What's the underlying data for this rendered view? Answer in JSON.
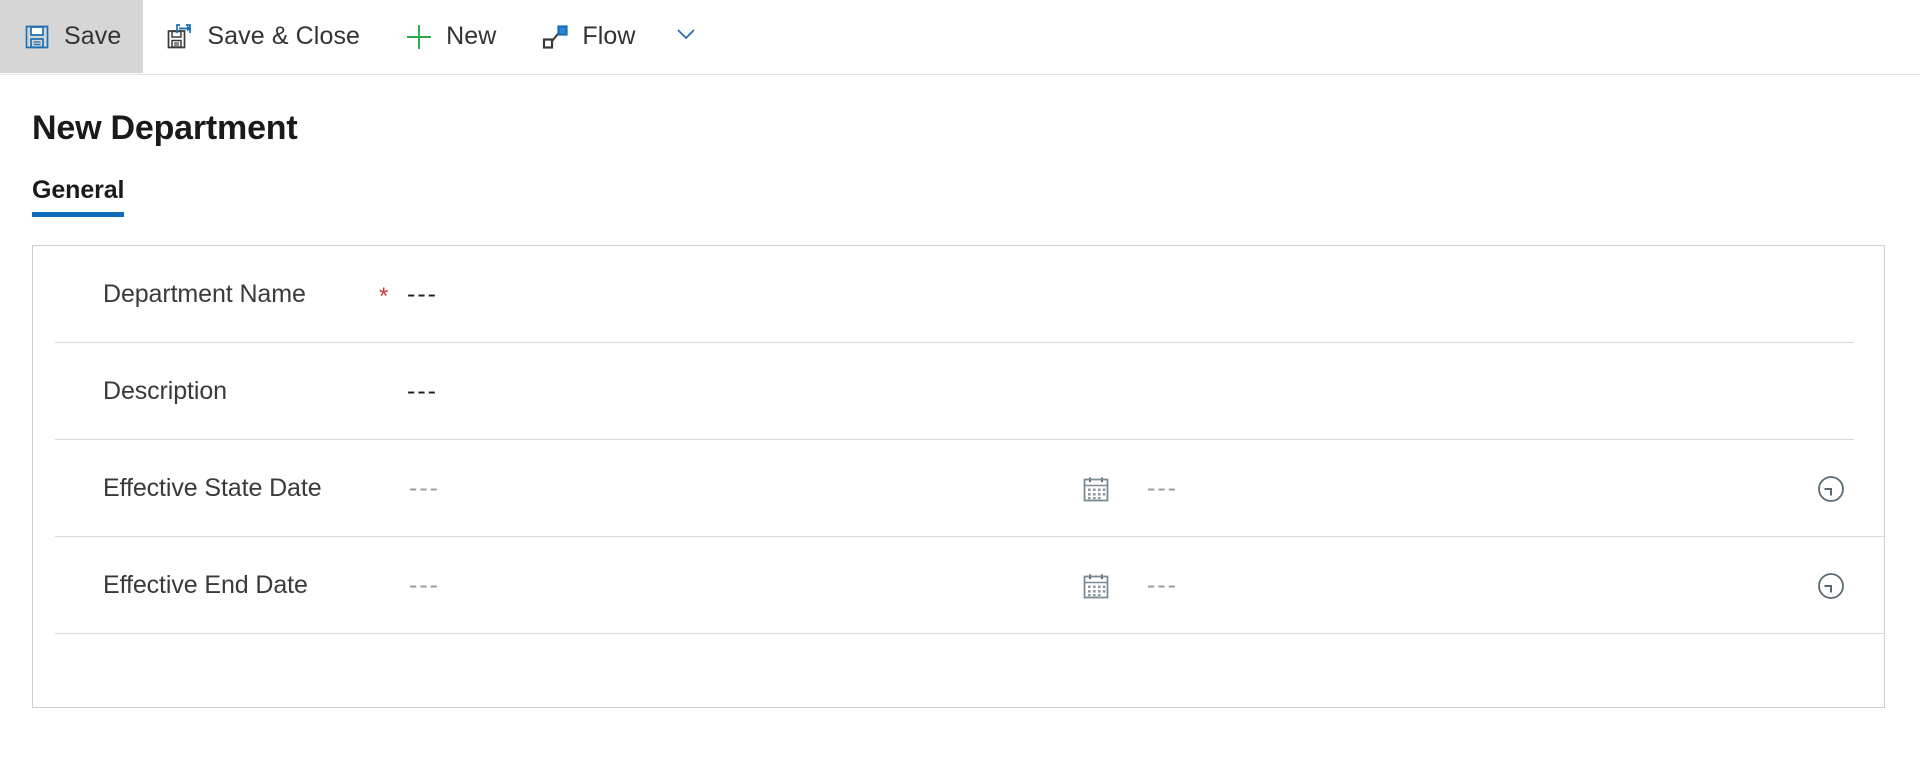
{
  "commandbar": {
    "buttons": [
      {
        "id": "save",
        "label": "Save",
        "icon": "save-icon",
        "active": true
      },
      {
        "id": "save-close",
        "label": "Save & Close",
        "icon": "save-close-icon",
        "active": false
      },
      {
        "id": "new",
        "label": "New",
        "icon": "plus-icon",
        "active": false
      },
      {
        "id": "flow",
        "label": "Flow",
        "icon": "flow-icon",
        "active": false
      }
    ],
    "overflow_icon": "chevron-down-icon"
  },
  "header": {
    "title": "New Department"
  },
  "tabs": [
    {
      "id": "general",
      "label": "General",
      "selected": true
    }
  ],
  "form": {
    "rows": [
      {
        "id": "department-name",
        "label": "Department Name",
        "required": true,
        "required_marker": "*",
        "value": "---",
        "type": "text"
      },
      {
        "id": "description",
        "label": "Description",
        "required": false,
        "required_marker": "",
        "value": "---",
        "type": "text"
      },
      {
        "id": "effective-state-date",
        "label": "Effective State Date",
        "required": false,
        "required_marker": "",
        "value": "---",
        "time_value": "---",
        "type": "datetime",
        "date_icon": "calendar-icon",
        "time_icon": "clock-icon"
      },
      {
        "id": "effective-end-date",
        "label": "Effective End Date",
        "required": false,
        "required_marker": "",
        "value": "---",
        "time_value": "---",
        "type": "datetime",
        "date_icon": "calendar-icon",
        "time_icon": "clock-icon"
      }
    ]
  },
  "colors": {
    "accent": "#0f6cbd",
    "required": "#d13438",
    "icon_blue": "#1a6fb5",
    "icon_green": "#2aa84a",
    "icon_dark": "#3b3a39",
    "toolbar_active_bg": "#d6d6d6",
    "border": "#cfcfcf",
    "row_divider": "#d9d9d9",
    "muted_text": "#9a9a9a"
  }
}
